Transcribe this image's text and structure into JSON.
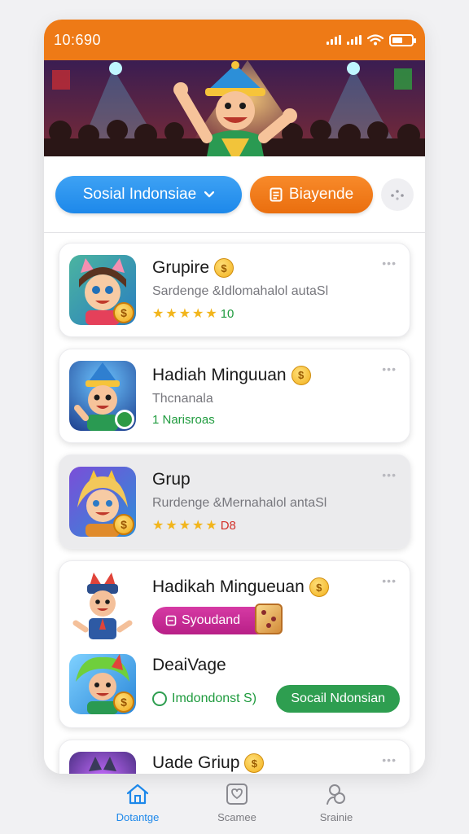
{
  "status_bar": {
    "time": "10:690"
  },
  "filters": {
    "primary_dropdown": "Sosial Indonsiae",
    "secondary_button": "Biayende"
  },
  "items": [
    {
      "title": "Grupire",
      "subtitle": "Sardenge &Idlomahalol autaSl",
      "rating_text": "10",
      "stars": 5
    },
    {
      "title": "Hadiah Minguuan",
      "subtitle": "Thcnanala",
      "status_text": "1 Narisroas"
    },
    {
      "title": "Grup",
      "subtitle": "Rurdenge &Mernahalol antaSl",
      "rating_text": "D8",
      "stars": 5
    },
    {
      "title": "Hadikah Mingueuan",
      "tag_label": "Syoudand",
      "sub_title": "DeaiVage",
      "sub_status": "Imdondonst S)",
      "sub_button": "Socail Ndonsian"
    },
    {
      "title": "Uade Griup"
    }
  ],
  "bottom_nav": [
    {
      "label": "Dotantge",
      "icon": "home-icon",
      "active": true
    },
    {
      "label": "Scamee",
      "icon": "chat-icon",
      "active": false
    },
    {
      "label": "Srainie",
      "icon": "people-icon",
      "active": false
    }
  ],
  "colors": {
    "header_orange": "#ee7a16",
    "primary_blue": "#1d88ea",
    "accent_orange": "#f07a1a",
    "success_green": "#2e9e50",
    "tag_pink": "#c52a94"
  }
}
